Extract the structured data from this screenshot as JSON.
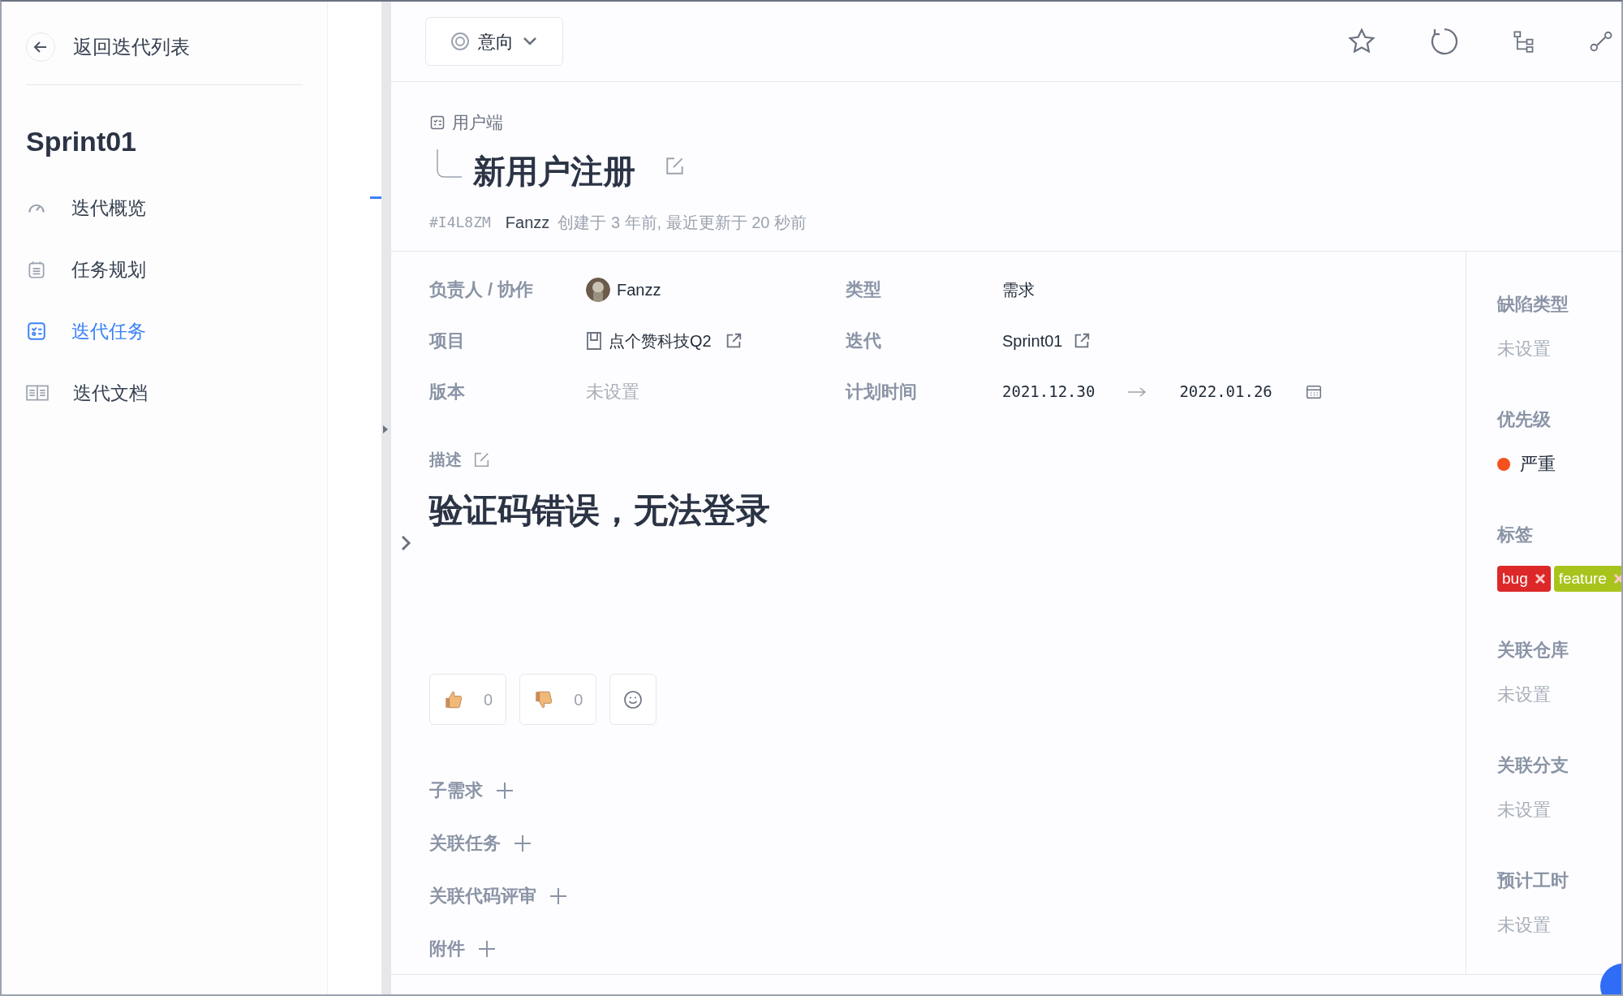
{
  "sidebar": {
    "back_link": "返回迭代列表",
    "title": "Sprint01",
    "items": [
      {
        "label": "迭代概览",
        "selected": false
      },
      {
        "label": "任务规划",
        "selected": false
      },
      {
        "label": "迭代任务",
        "selected": true
      },
      {
        "label": "迭代文档",
        "selected": false
      }
    ]
  },
  "toolbar": {
    "status": "意向"
  },
  "issue": {
    "parent": "用户端",
    "title": "新用户注册",
    "id": "#I4L8ZM",
    "author": "Fanzz",
    "meta": "创建于 3 年前, 最近更新于 20 秒前"
  },
  "fields": [
    {
      "label": "负责人 / 协作",
      "kind": "user",
      "value": "Fanzz"
    },
    {
      "label": "类型",
      "kind": "text",
      "value": "需求"
    },
    {
      "label": "项目",
      "kind": "project",
      "value": "点个赞科技Q2"
    },
    {
      "label": "迭代",
      "kind": "link",
      "value": "Sprint01"
    },
    {
      "label": "版本",
      "kind": "empty",
      "value": "未设置"
    },
    {
      "label": "计划时间",
      "kind": "daterange",
      "start": "2021.12.30",
      "end": "2022.01.26"
    }
  ],
  "description": {
    "label": "描述",
    "text": "验证码错误，无法登录"
  },
  "reactions": [
    {
      "kind": "up",
      "count": "0"
    },
    {
      "kind": "down",
      "count": "0"
    },
    {
      "kind": "emoji"
    }
  ],
  "sections": [
    "子需求",
    "关联任务",
    "关联代码评审",
    "附件"
  ],
  "side_panel": [
    {
      "label": "缺陷类型",
      "kind": "empty",
      "value": "未设置"
    },
    {
      "label": "优先级",
      "kind": "priority",
      "value": "严重",
      "color": "#f4511e"
    },
    {
      "label": "标签",
      "kind": "tags",
      "tags": [
        {
          "label": "bug",
          "color": "#dc2828"
        },
        {
          "label": "feature",
          "color": "#a8c41c"
        }
      ]
    },
    {
      "label": "关联仓库",
      "kind": "empty",
      "value": "未设置"
    },
    {
      "label": "关联分支",
      "kind": "empty",
      "value": "未设置"
    },
    {
      "label": "预计工时",
      "kind": "empty",
      "value": "未设置"
    }
  ]
}
